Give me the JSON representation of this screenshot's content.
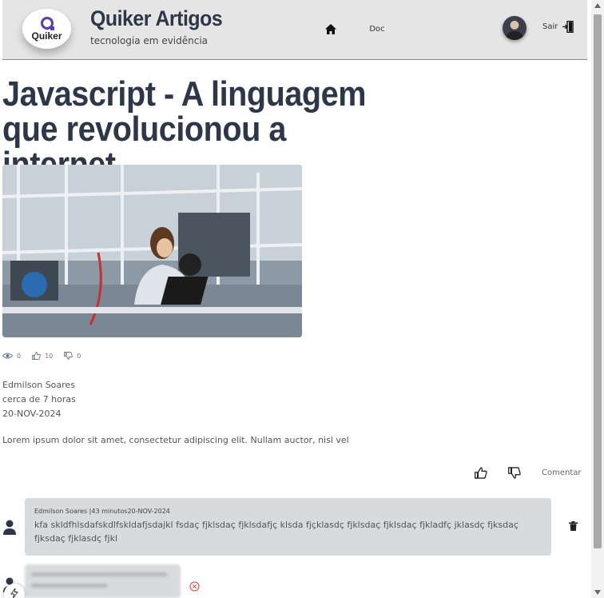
{
  "header": {
    "logo_text": "Quiker",
    "title": "Quiker Artigos",
    "subtitle": "tecnologia em evidência",
    "doc_label": "Doc",
    "logout_label": "Sair"
  },
  "article": {
    "title": "Javascript - A linguagem que revolucionou a internet",
    "views": "0",
    "likes": "10",
    "dislikes": "0",
    "author": "Edmilson Soares",
    "relative_time": "cerca de 7 horas",
    "date": "20-NOV-2024",
    "body": "Lorem ipsum dolor sit amet, consectetur adipiscing elit. Nullam auctor, nisl vel"
  },
  "actions": {
    "comment_label": "Comentar"
  },
  "comments": [
    {
      "meta": "Edmilson Soares |43 minutos20-NOV-2024",
      "text": "kfa skldfhlsdafskdlfskldafjsdajkl fsdaç fjklsdaç fjklsdafjç klsda fjçklasdç fjklsdaç fjklsdaç fjkladfç jklasdç fjksdaç fjksdaç fjklasdç fjkl"
    }
  ],
  "colors": {
    "header_bg": "#e5e5e5",
    "title_color": "#2d3748",
    "comment_bg": "#d9dadd",
    "logo_accent": "#5b3bb0",
    "cancel_red": "#e53e3e"
  }
}
